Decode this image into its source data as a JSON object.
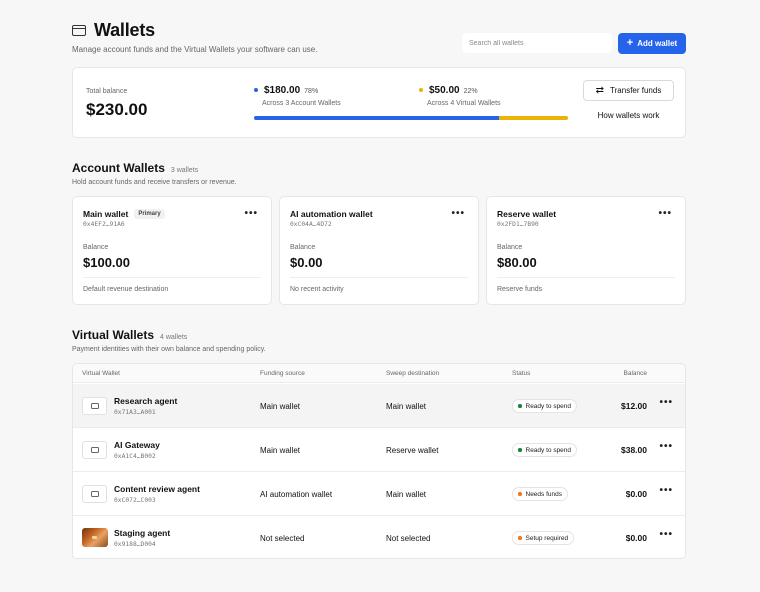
{
  "header": {
    "title": "Wallets",
    "subtitle": "Manage account funds and the Virtual Wallets your software can use.",
    "search_placeholder": "Search all wallets",
    "add_button": "Add wallet"
  },
  "summary": {
    "total_label": "Total balance",
    "total_value": "$230.00",
    "account": {
      "amount": "$180.00",
      "pct": "78%",
      "sub": "Across 3 Account Wallets",
      "fraction": 0.78,
      "color": "#2563eb"
    },
    "virtual": {
      "amount": "$50.00",
      "pct": "22%",
      "sub": "Across 4 Virtual Wallets",
      "fraction": 0.22,
      "color": "#eab308"
    },
    "transfer_button": "Transfer funds",
    "how_link": "How wallets work"
  },
  "account_section": {
    "title": "Account Wallets",
    "count": "3 wallets",
    "subtitle": "Hold account funds and receive transfers or revenue.",
    "wallets": [
      {
        "name": "Main wallet",
        "badge": "Primary",
        "address": "0x4EF2…91A6",
        "balance_label": "Balance",
        "balance": "$100.00",
        "note": "Default revenue destination"
      },
      {
        "name": "AI automation wallet",
        "badge": "",
        "address": "0xC04A…4D72",
        "balance_label": "Balance",
        "balance": "$0.00",
        "note": "No recent activity"
      },
      {
        "name": "Reserve wallet",
        "badge": "",
        "address": "0x2FD1…7B90",
        "balance_label": "Balance",
        "balance": "$80.00",
        "note": "Reserve funds"
      }
    ]
  },
  "virtual_section": {
    "title": "Virtual Wallets",
    "count": "4 wallets",
    "subtitle": "Payment identities with their own balance and spending policy.",
    "columns": [
      "Virtual Wallet",
      "Funding source",
      "Sweep destination",
      "Status",
      "Balance"
    ],
    "rows": [
      {
        "name": "Research agent",
        "address": "0x71A3…A001",
        "funding": "Main wallet",
        "sweep": "Main wallet",
        "status": "Ready to spend",
        "status_color": "#16803c",
        "balance": "$12.00",
        "icon": "card-icon"
      },
      {
        "name": "AI Gateway",
        "address": "0xA1C4…B002",
        "funding": "Main wallet",
        "sweep": "Reserve wallet",
        "status": "Ready to spend",
        "status_color": "#16803c",
        "balance": "$38.00",
        "icon": "card-icon"
      },
      {
        "name": "Content review agent",
        "address": "0xC072…C003",
        "funding": "AI automation wallet",
        "sweep": "Main wallet",
        "status": "Needs funds",
        "status_color": "#f97316",
        "balance": "$0.00",
        "icon": "card-icon"
      },
      {
        "name": "Staging agent",
        "address": "0x9188…D004",
        "funding": "Not selected",
        "sweep": "Not selected",
        "status": "Setup required",
        "status_color": "#f97316",
        "balance": "$0.00",
        "icon": "card-image"
      }
    ]
  }
}
